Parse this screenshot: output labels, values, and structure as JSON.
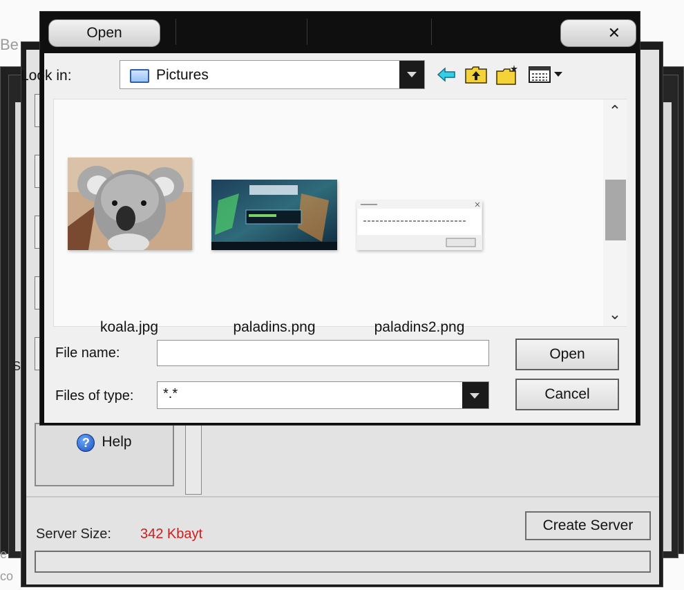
{
  "dialog": {
    "title": "Open",
    "close_glyph": "✕",
    "look_in_label": "Look in:",
    "look_in_value": "Pictures",
    "toolbar_icons": [
      "back-arrow-icon",
      "up-one-level-icon",
      "create-new-folder-icon",
      "view-menu-icon"
    ],
    "files": [
      {
        "name": "koala.jpg",
        "thumbnail": "koala-photo"
      },
      {
        "name": "paladins.png",
        "thumbnail": "paladins-game-screenshot"
      },
      {
        "name": "paladins2.png",
        "thumbnail": "message-box-screenshot"
      }
    ],
    "file_name_label": "File name:",
    "file_name_value": "",
    "files_of_type_label": "Files of type:",
    "files_of_type_value": "*.*",
    "open_button": "Open",
    "cancel_button": "Cancel"
  },
  "app": {
    "help_button": "Help",
    "server_size_label": "Server Size:",
    "server_size_value": "342 Kbayt",
    "create_server_button": "Create Server",
    "progress": 0,
    "colors": {
      "server_size_value": "#d21b1b"
    }
  },
  "background": {
    "partial_texts": [
      "Be",
      "I",
      "S",
      "e",
      "co"
    ]
  }
}
